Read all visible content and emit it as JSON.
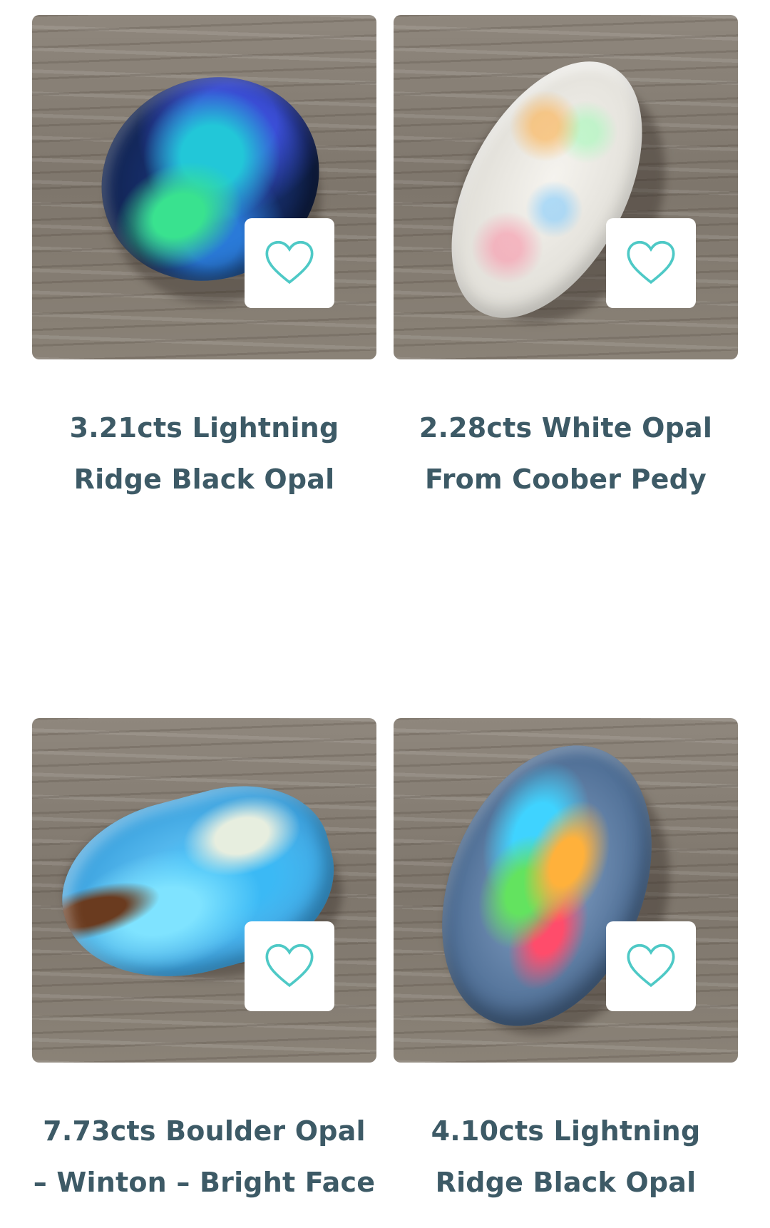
{
  "products": [
    {
      "title": "3.21cts Lightning Ridge Black Opal"
    },
    {
      "title": "2.28cts White Opal From Coober Pedy"
    },
    {
      "title": "7.73cts Boulder Opal – Winton – Bright Face"
    },
    {
      "title": "4.10cts Lightning Ridge Black Opal"
    }
  ],
  "icons": {
    "favorite": "heart-outline-icon"
  },
  "colors": {
    "accent": "#4ec9c6",
    "title_text": "#3d5a66"
  }
}
